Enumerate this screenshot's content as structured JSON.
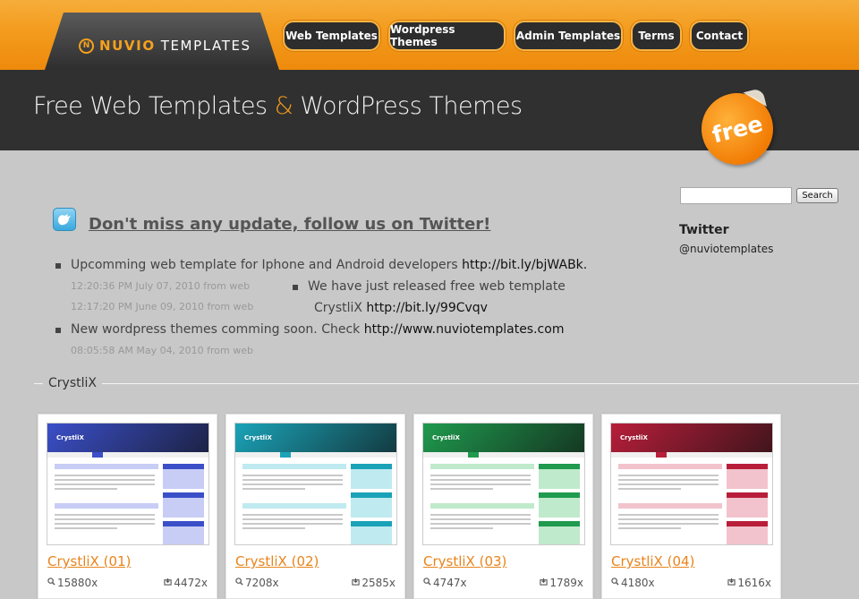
{
  "header": {
    "logo_part1": "NUVIO",
    "logo_part2": "TEMPLATES",
    "logo_mark": "N",
    "nav": [
      "Web Templates",
      "Wordpress Themes",
      "Admin Templates",
      "Terms",
      "Contact"
    ],
    "hero_part1": "Free Web Templates",
    "hero_amp": "&",
    "hero_part2": "WordPress Themes",
    "badge": "free"
  },
  "sidebar": {
    "search_placeholder": "",
    "search_button": "Search",
    "twitter_title": "Twitter",
    "twitter_handle": "@nuviotemplates"
  },
  "twitter": {
    "follow": "Don't miss any update, follow us on Twitter!",
    "tweets": [
      {
        "text": "Upcomming web template for Iphone and Android developers ",
        "link": "http://bit.ly/bjWABk.",
        "meta": "12:20:36 PM July 07, 2010 from web"
      },
      {
        "text": "We have just released free web template",
        "text2": "CrystliX ",
        "link": "http://bit.ly/99Cvqv",
        "meta": "12:17:20 PM June 09, 2010 from web"
      },
      {
        "text": "New wordpress themes comming soon. Check ",
        "link": "http://www.nuviotemplates.com",
        "meta": "08:05:58 AM May 04, 2010 from web"
      }
    ]
  },
  "section": {
    "title": "CrystliX",
    "cards": [
      {
        "title": "CrystliX (01)",
        "views": "15880x",
        "downloads": "4472x",
        "color": "#3b4fc8",
        "light": "#c7cdf5"
      },
      {
        "title": "CrystliX (02)",
        "views": "7208x",
        "downloads": "2585x",
        "color": "#1aa3b8",
        "light": "#bfeaf0"
      },
      {
        "title": "CrystliX (03)",
        "views": "4747x",
        "downloads": "1789x",
        "color": "#1f9a4e",
        "light": "#bfeacb"
      },
      {
        "title": "CrystliX (04)",
        "views": "4180x",
        "downloads": "1616x",
        "color": "#b81e3a",
        "light": "#f2c3cc"
      }
    ],
    "thumb_logo": "CrystliX"
  },
  "icons": {
    "views": "magnifier-icon",
    "downloads": "download-icon",
    "twitter": "twitter-bird-icon"
  }
}
